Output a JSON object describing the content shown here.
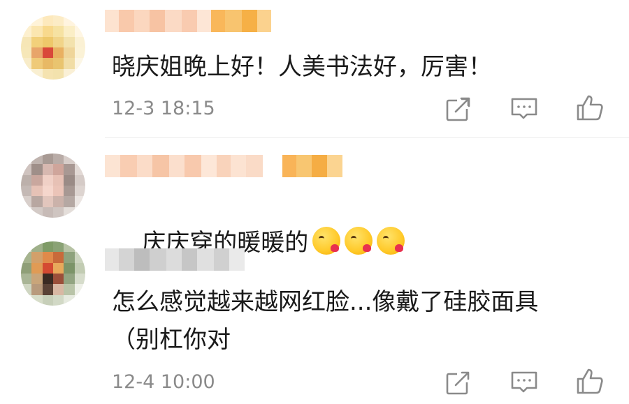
{
  "comments": [
    {
      "text": "晓庆姐晚上好！人美书法好，厉害！",
      "time": "12-3 18:15",
      "emoji_count": 0
    },
    {
      "text": "庆庆穿的暖暖的",
      "time": "",
      "emoji_count": 3,
      "emoji_name": "kissing-heart"
    },
    {
      "text": "怎么感觉越来越网红脸...像戴了硅胶面具\n（别杠你对",
      "time": "12-4 10:00",
      "emoji_count": 0
    }
  ],
  "actions": {
    "share_icon": "share-icon",
    "reply_icon": "comment-icon",
    "like_icon": "thumbs-up-icon"
  },
  "colors": {
    "text": "#1a1a1a",
    "meta": "#8a8a8a",
    "icon": "#8a8a8a",
    "badge": "#f8b54a"
  }
}
